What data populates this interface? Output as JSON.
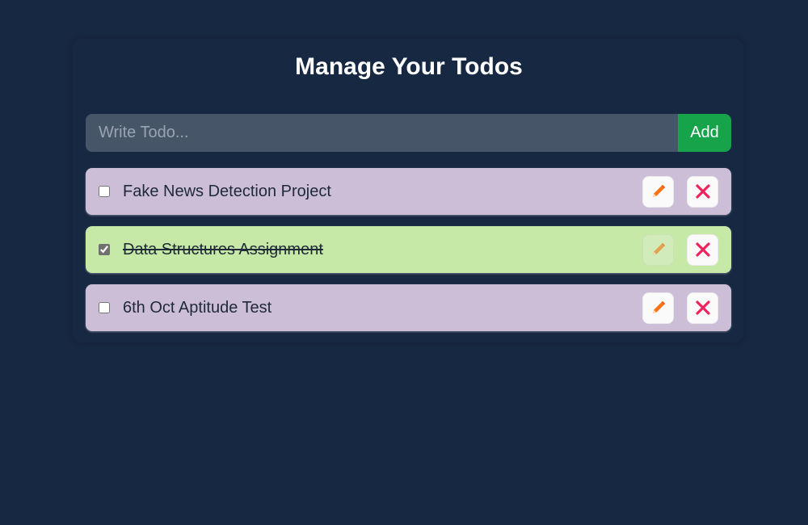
{
  "header": {
    "title": "Manage Your Todos"
  },
  "form": {
    "input_value": "",
    "input_placeholder": "Write Todo...",
    "add_label": "Add"
  },
  "todos": [
    {
      "text": "Fake News Detection Project",
      "completed": false
    },
    {
      "text": "Data Structures Assignment",
      "completed": true
    },
    {
      "text": "6th Oct Aptitude Test",
      "completed": false
    }
  ],
  "icons": {
    "edit": "pencil-icon",
    "delete": "close-icon"
  },
  "colors": {
    "background": "#172842",
    "input_bg": "#475569",
    "add_button": "#16a34a",
    "pending_item": "#ccbed7",
    "completed_item": "#c6e9a7",
    "delete_icon": "#f0245c",
    "edit_icon": "#f97316"
  }
}
